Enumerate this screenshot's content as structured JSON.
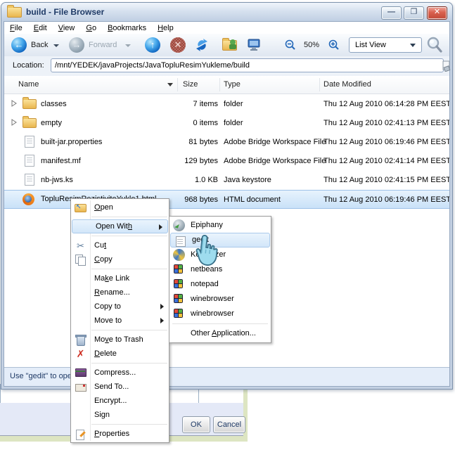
{
  "window": {
    "title": "build - File Browser",
    "status_text": "Use \"gedit\" to open",
    "minimize_glyph": "—",
    "maximize_glyph": "❐",
    "close_glyph": "✕"
  },
  "menubar": [
    {
      "label": "File",
      "mi": 0
    },
    {
      "label": "Edit",
      "mi": 0
    },
    {
      "label": "View",
      "mi": 0
    },
    {
      "label": "Go",
      "mi": 0
    },
    {
      "label": "Bookmarks",
      "mi": 0
    },
    {
      "label": "Help",
      "mi": 0
    }
  ],
  "toolbar": {
    "back_label": "Back",
    "forward_label": "Forward",
    "zoom_level": "50%",
    "view_mode": "List View"
  },
  "location": {
    "label": "Location:",
    "value": "/mnt/YEDEK/javaProjects/JavaTopluResimYukleme/build"
  },
  "filelist": {
    "columns": {
      "name": "Name",
      "size": "Size",
      "type": "Type",
      "modified": "Date Modified"
    },
    "rows": [
      {
        "name": "classes",
        "size": "7 items",
        "type": "folder",
        "modified": "Thu 12 Aug 2010 06:14:28 PM EEST"
      },
      {
        "name": "empty",
        "size": "0 items",
        "type": "folder",
        "modified": "Thu 12 Aug 2010 02:41:13 PM EEST"
      },
      {
        "name": "built-jar.properties",
        "size": "81 bytes",
        "type": "Adobe Bridge Workspace File",
        "modified": "Thu 12 Aug 2010 06:19:46 PM EEST"
      },
      {
        "name": "manifest.mf",
        "size": "129 bytes",
        "type": "Adobe Bridge Workspace File",
        "modified": "Thu 12 Aug 2010 02:41:14 PM EEST"
      },
      {
        "name": "nb-jws.ks",
        "size": "1.0 KB",
        "type": "Java keystore",
        "modified": "Thu 12 Aug 2010 02:41:15 PM EEST"
      },
      {
        "name": "TopluResimRezistiviteYukle1.html",
        "size": "968 bytes",
        "type": "HTML document",
        "modified": "Thu 12 Aug 2010 06:19:46 PM EEST"
      }
    ]
  },
  "context_menu": {
    "items": [
      {
        "label": "Open",
        "mi": 0
      },
      {
        "label": "Open With",
        "mi": 8
      },
      {
        "label": "Cut",
        "mi": 2
      },
      {
        "label": "Copy",
        "mi": 0
      },
      {
        "label": "Make Link",
        "mi": 2
      },
      {
        "label": "Rename...",
        "mi": 0
      },
      {
        "label": "Copy to"
      },
      {
        "label": "Move to"
      },
      {
        "label": "Move to Trash",
        "mi": 2
      },
      {
        "label": "Delete",
        "mi": 0
      },
      {
        "label": "Compress..."
      },
      {
        "label": "Send To..."
      },
      {
        "label": "Encrypt..."
      },
      {
        "label": "Sign"
      },
      {
        "label": "Properties",
        "mi": 0
      }
    ]
  },
  "open_with_menu": {
    "items": [
      {
        "label": "Epiphany"
      },
      {
        "label": "gedit"
      },
      {
        "label": "Kompozer"
      },
      {
        "label": "netbeans"
      },
      {
        "label": "notepad"
      },
      {
        "label": "winebrowser"
      },
      {
        "label": "winebrowser"
      },
      {
        "label": "Other Application...",
        "mi": 6
      }
    ]
  },
  "dialog": {
    "ok_label": "OK",
    "cancel_label": "Cancel"
  },
  "colors": {
    "selection": "#c9e1f8",
    "menu_highlight": "#d2e6f9",
    "title_text": "#1f3a66"
  }
}
